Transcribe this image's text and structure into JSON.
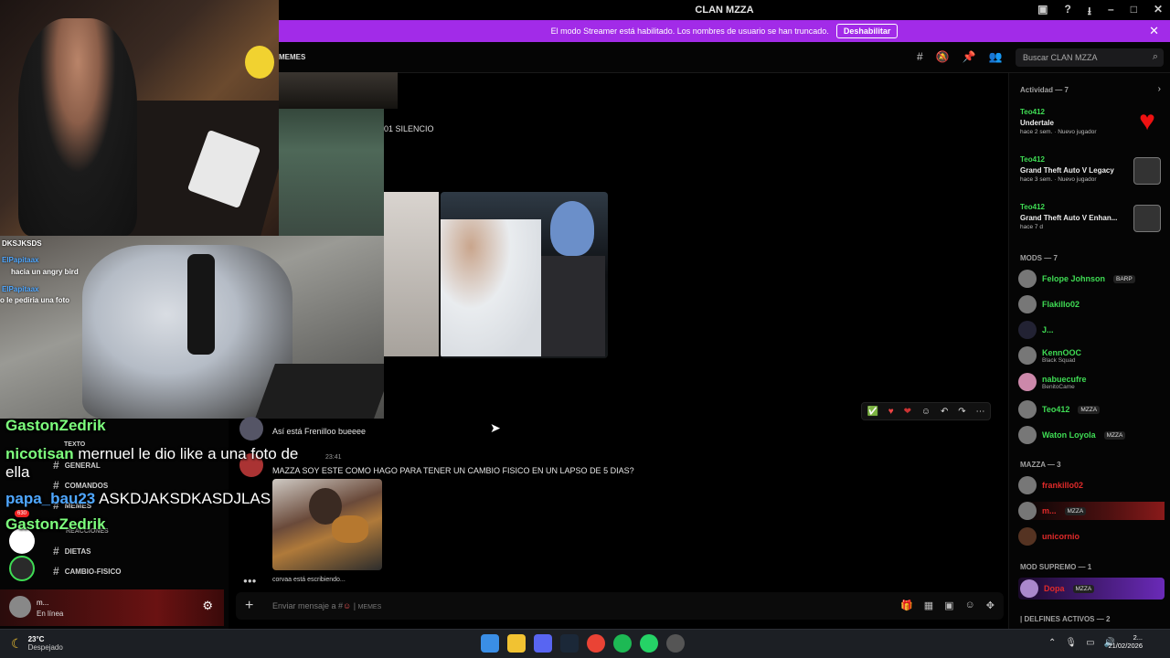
{
  "window": {
    "title": "CLAN MZZA"
  },
  "banner": {
    "text": "El modo Streamer está habilitado. Los nombres de usuario se han truncado.",
    "button": "Deshabilitar"
  },
  "header": {
    "channel": "MEMES",
    "search_placeholder": "Buscar CLAN MZZA"
  },
  "cam_chat": [
    {
      "text": "DKSJKSDS"
    },
    {
      "user": "ElPapitaax",
      "text": "hacia un angry bird"
    },
    {
      "user": "ElPapitaax",
      "text": "o le pediria una foto"
    }
  ],
  "embed": {
    "caption": "01 SILENCIO"
  },
  "messages": [
    {
      "text": "Así está Frenilloo bueeee"
    },
    {
      "time": "23:41",
      "text": "MAZZA SOY ESTE COMO HAGO PARA TENER UN CAMBIO FISICO EN UN LAPSO DE 5 DIAS?"
    }
  ],
  "typing": "corvaa está escribiendo...",
  "composer": {
    "placeholder": "Enviar mensaje a #",
    "channel": "MEMES"
  },
  "channels": {
    "texto_cat": "TEXTO",
    "items": [
      "GENERAL",
      "COMANDOS",
      "MEMES",
      "DIETAS",
      "CAMBIO-FISICO"
    ],
    "reacciones_cat": "REACCIONES"
  },
  "server_badge": "630",
  "user_panel": {
    "name": "m...",
    "status": "En línea"
  },
  "overlay_chat": [
    {
      "user": "GastonZedrik",
      "text": ""
    },
    {
      "user": "nicotisan",
      "text": "mernuel le dio like a una foto de ella"
    },
    {
      "user": "papa_bau23",
      "text": "ASKDJAKSDKASDJLAS"
    },
    {
      "user": "GastonZedrik",
      "text": ""
    }
  ],
  "members": {
    "activity_head": "Actividad — 7",
    "activities": [
      {
        "user": "Teo412",
        "game": "Undertale",
        "time": "hace 2 sem.",
        "badge": "Nuevo jugador"
      },
      {
        "user": "Teo412",
        "game": "Grand Theft Auto V Legacy",
        "time": "hace 3 sem.",
        "badge": "Nuevo jugador"
      },
      {
        "user": "Teo412",
        "game": "Grand Theft Auto V Enhan...",
        "time": "hace 7 d",
        "badge": ""
      }
    ],
    "mods_head": "MODS — 7",
    "mods": [
      {
        "name": "Felope Johnson",
        "tag": "BARP",
        "sub": ""
      },
      {
        "name": "Flakillo02",
        "tag": "",
        "sub": ""
      },
      {
        "name": "J...",
        "tag": "",
        "sub": ""
      },
      {
        "name": "KennOOC",
        "tag": "",
        "sub": "Black Squad"
      },
      {
        "name": "nabuecufre",
        "tag": "",
        "sub": "BenitoCame"
      },
      {
        "name": "Teo412",
        "tag": "MZZA",
        "sub": ""
      },
      {
        "name": "Waton Loyola",
        "tag": "MZZA",
        "sub": ""
      }
    ],
    "mazza_head": "MAZZA — 3",
    "mazza": [
      {
        "name": "frankillo02",
        "tag": ""
      },
      {
        "name": "m...",
        "tag": "MZZA"
      },
      {
        "name": "unicornio",
        "tag": ""
      }
    ],
    "supremo_head": "MOD SUPREMO — 1",
    "supremo": [
      {
        "name": "Dopa",
        "tag": "MZZA"
      }
    ],
    "delfines_head": "| DELFINES ACTIVOS — 2"
  },
  "taskbar": {
    "temp": "23°C",
    "weather": "Despejado",
    "time": "2...",
    "date": "21/02/2026"
  },
  "colors": {
    "banner": "#a22be8",
    "online_green": "#3fdc54",
    "mazza_red": "#e02a2a"
  }
}
